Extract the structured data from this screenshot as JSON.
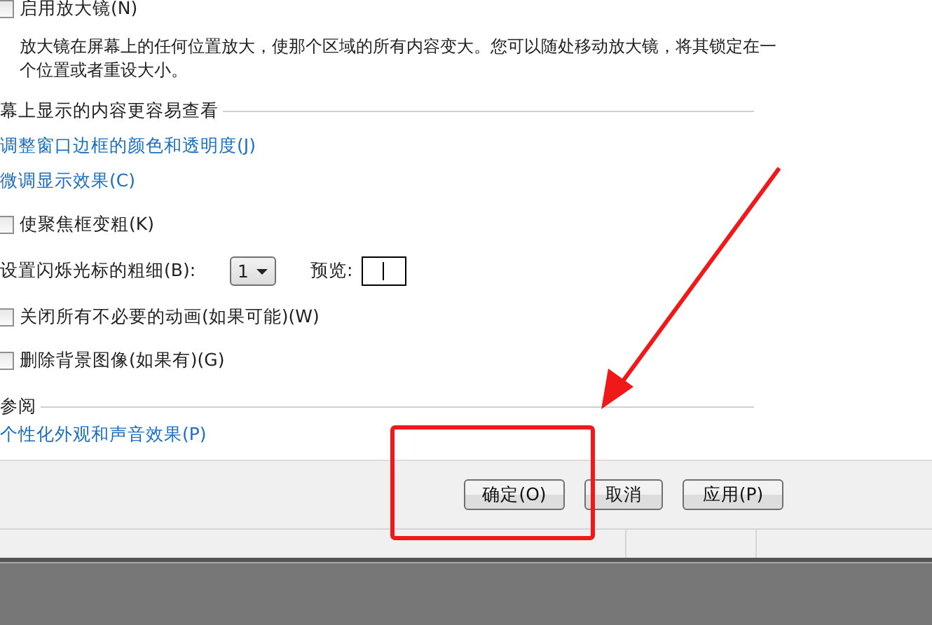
{
  "magnifier": {
    "label": "启用放大镜(N)",
    "checked": false,
    "description": "放大镜在屏幕上的任何位置放大，使那个区域的所有内容变大。您可以随处移动放大镜，将其锁定在一个位置或者重设大小。"
  },
  "section": {
    "title": "幕上显示的内容更容易查看",
    "links": [
      "调整窗口边框的颜色和透明度(J)",
      "微调显示效果(C)"
    ],
    "items": [
      {
        "kind": "checkbox",
        "label": "使聚焦框变粗(K)",
        "checked": false
      },
      {
        "kind": "dropdown",
        "label": "设置闪烁光标的粗细(B):",
        "value": "1",
        "preview_label": "预览:"
      },
      {
        "kind": "checkbox",
        "label": "关闭所有不必要的动画(如果可能)(W)",
        "checked": false
      },
      {
        "kind": "checkbox",
        "label": "删除背景图像(如果有)(G)",
        "checked": false
      }
    ]
  },
  "see_also": {
    "title": "参阅",
    "links": [
      "个性化外观和声音效果(P)"
    ]
  },
  "buttons": [
    "确定(O)",
    "取消",
    "应用(P)"
  ]
}
